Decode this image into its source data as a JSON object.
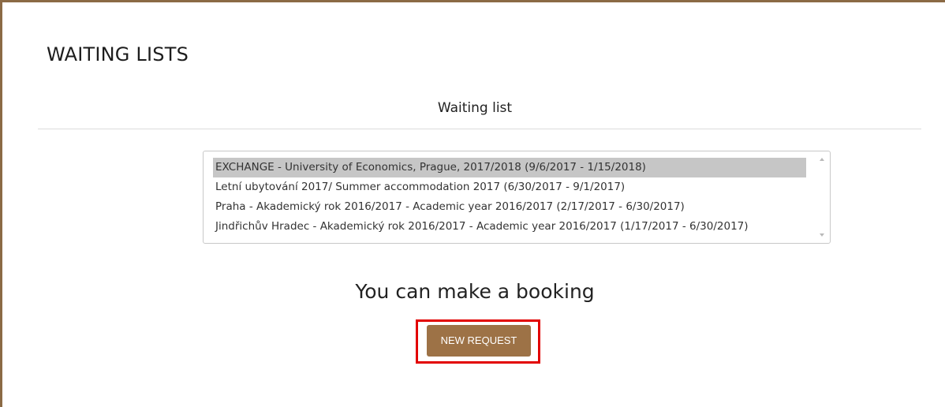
{
  "page": {
    "title": "WAITING LISTS"
  },
  "section": {
    "title": "Waiting list"
  },
  "waiting_list": {
    "items": [
      {
        "label": "EXCHANGE - University of Economics, Prague, 2017/2018 (9/6/2017 - 1/15/2018)",
        "selected": true
      },
      {
        "label": "Letní ubytování 2017/ Summer accommodation 2017 (6/30/2017 - 9/1/2017)",
        "selected": false
      },
      {
        "label": "Praha - Akademický rok 2016/2017 - Academic year 2016/2017 (2/17/2017 - 6/30/2017)",
        "selected": false
      },
      {
        "label": "Jindřichův Hradec - Akademický rok 2016/2017 - Academic year 2016/2017 (1/17/2017 - 6/30/2017)",
        "selected": false
      }
    ]
  },
  "booking": {
    "message": "You can make a booking",
    "button_label": "NEW REQUEST"
  },
  "icons": {
    "scroll_up": "chevron-up-icon",
    "scroll_down": "chevron-down-icon"
  },
  "colors": {
    "frame_border": "#8b6a45",
    "button_bg": "#9d7246",
    "highlight": "#e20000",
    "selected_item_bg": "#c6c6c6"
  }
}
